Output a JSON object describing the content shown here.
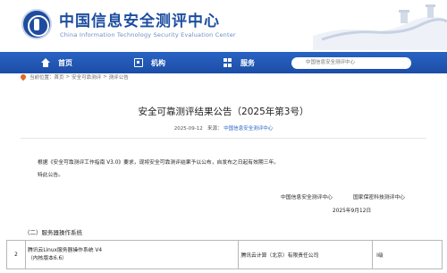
{
  "header": {
    "title": "中国信息安全测评中心",
    "subtitle": "China Information Technology Security Evaluation Center"
  },
  "nav": {
    "home": "首页",
    "org": "机构",
    "service": "服务",
    "search_placeholder": "中国信息安全测评中心"
  },
  "breadcrumb": {
    "prefix": "当前位置：",
    "items": [
      "首页",
      "安全可靠测评",
      "测评公告"
    ]
  },
  "article": {
    "title": "安全可靠测评结果公告（2025年第3号）",
    "date": "2025-09-12",
    "source_label": "来源：",
    "source": "中国信息安全测评中心",
    "paragraph1": "根据《安全可靠测评工作指南 V3.0》要求，现将安全可靠测评结果予以公布，自发布之日起有效期三年。",
    "paragraph2": "特此公告。",
    "sign_org1": "中国信息安全测评中心",
    "sign_org2": "国家保密科技测评中心",
    "sign_date": "2025年9月12日",
    "section_title": "（二）服务器操作系统"
  },
  "table": {
    "rows": [
      {
        "index": "2",
        "product_line1": "腾讯云Linux服务器操作系统 V4",
        "product_line2": "（内核版本6.6）",
        "vendor": "腾讯云计算（北京）有限责任公司",
        "level": "Ⅰ级"
      }
    ]
  },
  "colors": {
    "brand_blue": "#1d4ea0",
    "nav_blue": "#2a63c4",
    "accent_orange": "#e06a20"
  }
}
